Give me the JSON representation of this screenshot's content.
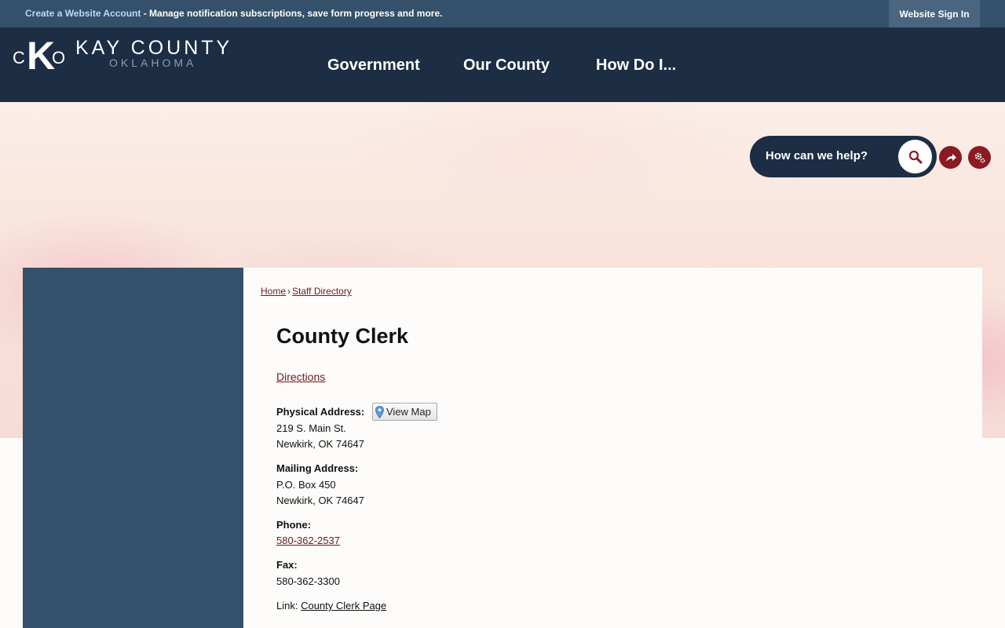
{
  "topbar": {
    "create_account": "Create a Website Account",
    "message": " - Manage notification subscriptions, save form progress and more.",
    "sign_in": "Website Sign In"
  },
  "logo": {
    "mark_left": "C",
    "mark_center": "K",
    "mark_right": "O",
    "name": "KAY COUNTY",
    "state": "OKLAHOMA"
  },
  "nav": {
    "items": [
      {
        "label": "Government"
      },
      {
        "label": "Our County"
      },
      {
        "label": "How Do I..."
      }
    ]
  },
  "search": {
    "placeholder": "How can we help?"
  },
  "icons": {
    "search": "search-icon",
    "share": "share-icon",
    "tools": "gear-icon",
    "map_pin": "map-pin-icon"
  },
  "colors": {
    "topbar": "#34506a",
    "header": "#1c2d44",
    "accent": "#8b1a22",
    "link": "#6b1a1f",
    "sidebar": "#34506a"
  },
  "breadcrumb": {
    "home": "Home",
    "separator": "›",
    "current": "Staff Directory"
  },
  "page": {
    "title": "County Clerk",
    "directions": "Directions",
    "view_map": "View Map",
    "physical_label": "Physical Address:",
    "physical_line1": "219 S. Main St.",
    "physical_line2": "Newkirk, OK 74647",
    "mailing_label": "Mailing Address:",
    "mailing_line1": "P.O. Box 450",
    "mailing_line2": "Newkirk, OK 74647",
    "phone_label": "Phone:",
    "phone": "580-362-2537",
    "fax_label": "Fax:",
    "fax": "580-362-3300",
    "link_label": "Link: ",
    "link_text": "County Clerk Page"
  }
}
